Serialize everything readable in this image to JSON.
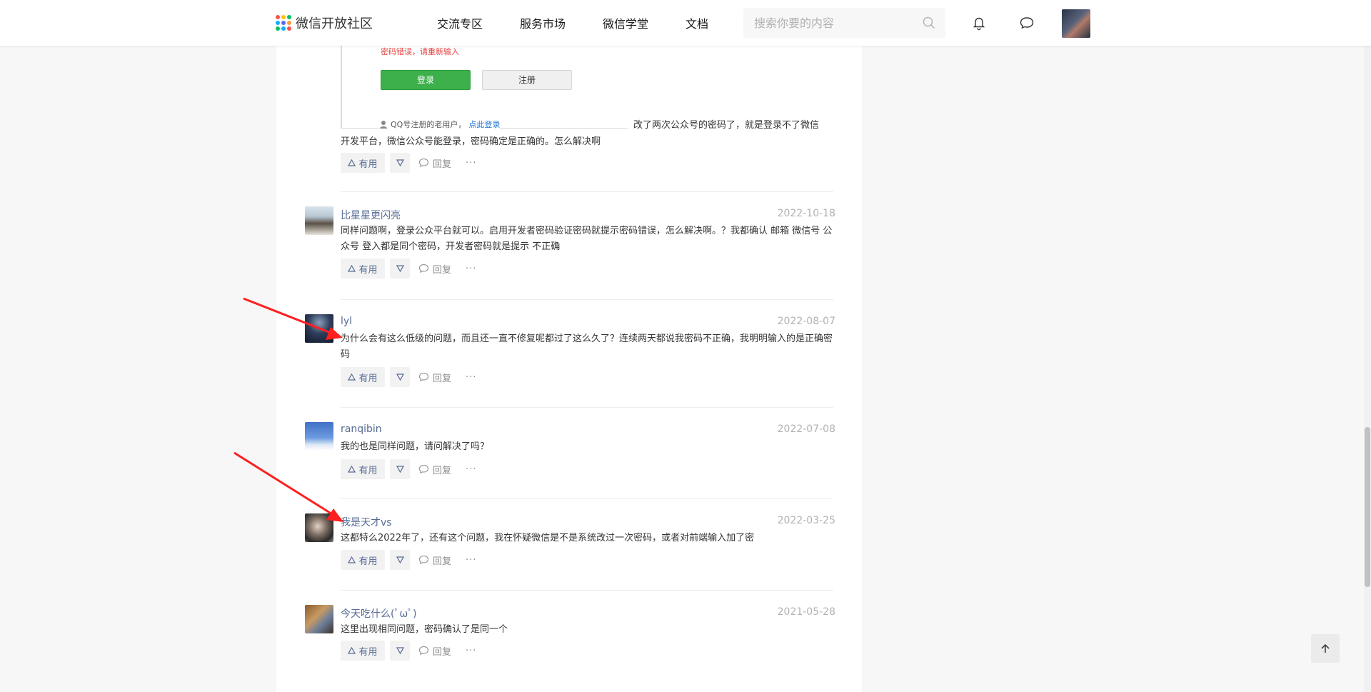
{
  "header": {
    "logo_text": "微信开放社区",
    "nav": [
      "交流专区",
      "服务市场",
      "微信学堂",
      "文档"
    ],
    "search_placeholder": "搜索你要的内容"
  },
  "first_answer": {
    "screenshot": {
      "error_text": "密码错误，请重新输入",
      "login_label": "登录",
      "register_label": "注册",
      "qq_text": "QQ号注册的老用户，",
      "qq_link": "点此登录"
    },
    "text_line1_right": "改了两次公众号的密码了，就是登录不了微信",
    "text_line2": "开发平台，微信公众号能登录，密码确定是正确的。怎么解决啊",
    "useful_label": "有用",
    "reply_label": "回复",
    "more_label": "···"
  },
  "answers": [
    {
      "name": "比星星更闪亮",
      "date": "2022-10-18",
      "text": "同样问题啊，登录公众平台就可以。启用开发者密码验证密码就提示密码错误，怎么解决啊。？我都确认 邮箱 微信号 公众号 登入都是同个密码，开发者密码就是提示 不正确",
      "useful_label": "有用",
      "reply_label": "回复",
      "more_label": "···"
    },
    {
      "name": "lyl",
      "date": "2022-08-07",
      "text": "为什么会有这么低级的问题，而且还一直不修复呢都过了这么久了？连续两天都说我密码不正确，我明明输入的是正确密码",
      "useful_label": "有用",
      "reply_label": "回复",
      "more_label": "···"
    },
    {
      "name": "ranqibin",
      "date": "2022-07-08",
      "text": "我的也是同样问题，请问解决了吗？",
      "useful_label": "有用",
      "reply_label": "回复",
      "more_label": "···"
    },
    {
      "name": "我是天才vs",
      "date": "2022-03-25",
      "text": "这都特么2022年了，还有这个问题，我在怀疑微信是不是系统改过一次密码，或者对前端输入加了密",
      "useful_label": "有用",
      "reply_label": "回复",
      "more_label": "···"
    },
    {
      "name": "今天吃什么(ﾟωﾟ)",
      "date": "2021-05-28",
      "text": "这里出现相同问题，密码确认了是同一个",
      "useful_label": "有用",
      "reply_label": "回复",
      "more_label": "···"
    }
  ],
  "colors": {
    "accent_link": "#576b95",
    "annotation_arrow": "#ff1f1f",
    "login_green": "#3db04c"
  }
}
